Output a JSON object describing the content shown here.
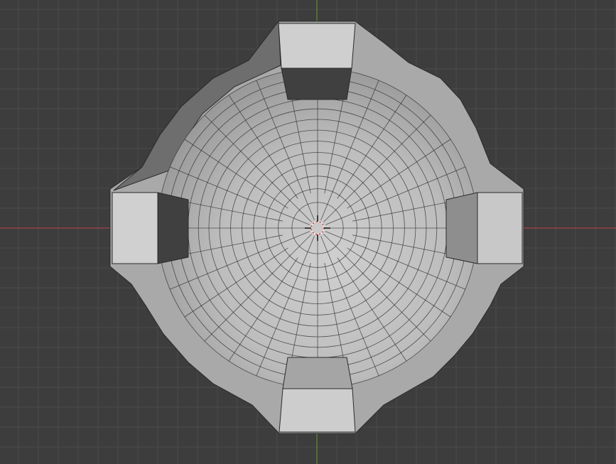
{
  "viewport": {
    "background_color": "#3d3d3d",
    "grid_color": "#4a4a4a",
    "x_axis_color": "#c0454a",
    "y_axis_color": "#6b9a2a",
    "mesh_fill_color": "#b9b9b9",
    "mesh_edge_color": "#2a2a2a",
    "cursor_color": "#e04040"
  },
  "mesh": {
    "radial_segments": 32,
    "ring_count": 13,
    "handle_count": 4
  },
  "cursor": {
    "icon": "3d-cursor-icon"
  }
}
